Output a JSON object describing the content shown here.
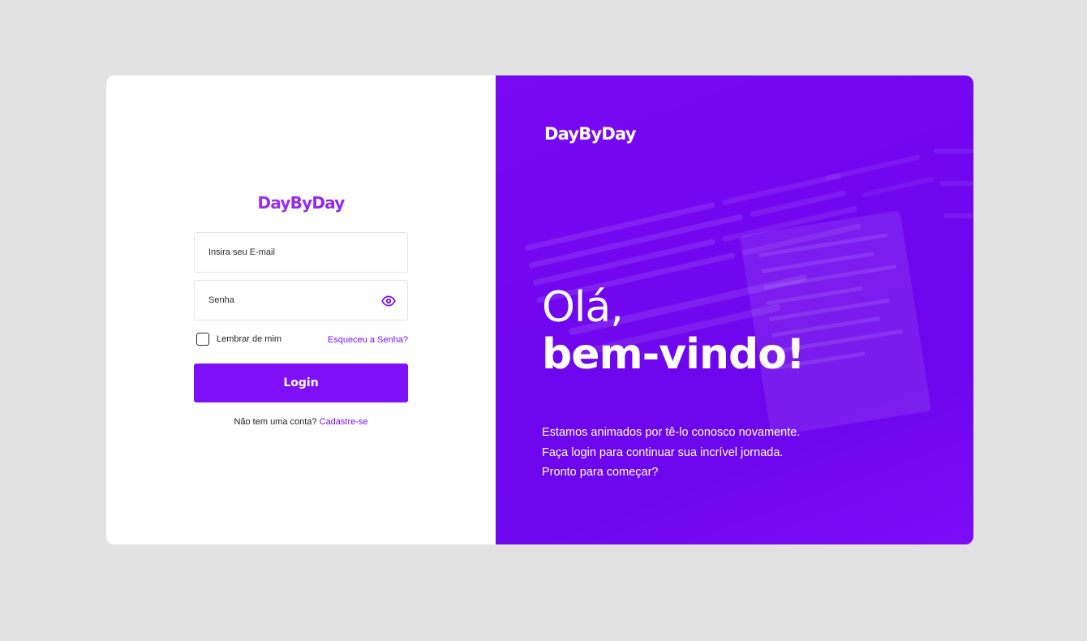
{
  "brand": {
    "name": "DayByDay"
  },
  "login_form": {
    "email_placeholder": "Insira seu E-mail",
    "password_placeholder": "Senha",
    "remember_label": "Lembrar de mim",
    "forgot_label": "Esqueceu a Senha?",
    "login_label": "Login",
    "signup_prompt": "Não tem uma conta?",
    "signup_link": "Cadastre-se"
  },
  "hero": {
    "greeting": "Olá,",
    "welcome": "bem-vindo!",
    "lines": [
      "Estamos animados por tê-lo conosco novamente.",
      "Faça login para continuar sua incrível jornada.",
      "Pronto para começar?"
    ]
  },
  "icons": {
    "password_toggle": "eye-icon"
  },
  "colors": {
    "accent": "#7f0ff6",
    "panel": "#7007ee",
    "page_bg": "#e2e2e2"
  }
}
